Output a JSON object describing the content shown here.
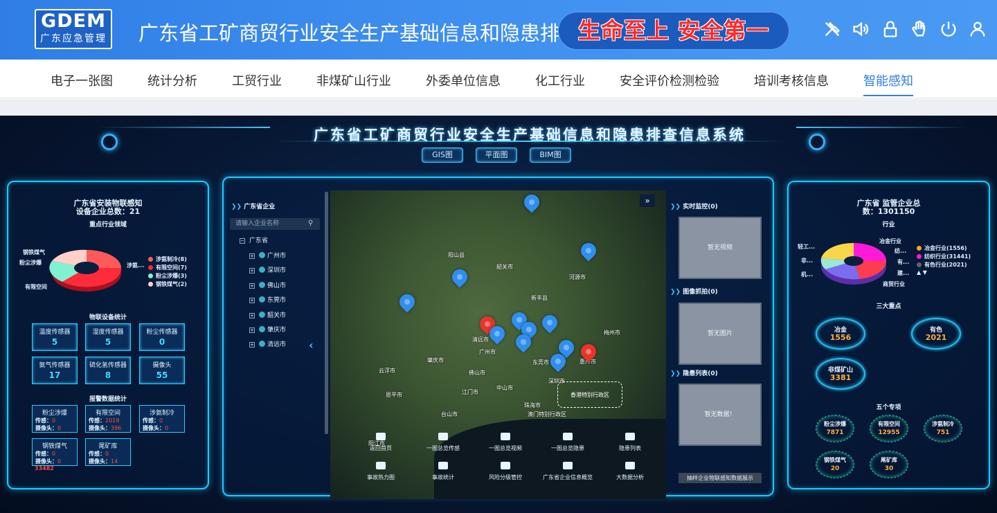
{
  "header": {
    "logo_main": "GDEM",
    "logo_sub": "广东应急管理",
    "title": "广东省工矿商贸行业安全生产基础信息和隐患排查信息系统",
    "slogan": "生命至上 安全第一",
    "icons": [
      "tools-icon",
      "speaker-icon",
      "lock-icon",
      "hand-icon",
      "power-icon",
      "user-icon"
    ]
  },
  "nav": {
    "items": [
      "电子一张图",
      "统计分析",
      "工贸行业",
      "非煤矿山行业",
      "外委单位信息",
      "化工行业",
      "安全评价检测检验",
      "培训考核信息",
      "智能感知"
    ],
    "active_index": 8
  },
  "dashboard": {
    "title": "广东省工矿商贸行业安全生产基础信息和隐患排查信息系统",
    "tabs": [
      "GIS图",
      "平面图",
      "BIM图"
    ]
  },
  "left_panel": {
    "title_line1": "广东省安装物联感知",
    "title_line2": "设备企业总数：21",
    "key_industry_title": "重点行业领域",
    "pie_labels": [
      "钢铁煤气",
      "粉尘涉爆",
      "有限空间",
      "涉氨..."
    ],
    "pie_legend": [
      {
        "label": "涉氨制冷(8)",
        "color": "#ff5a5a"
      },
      {
        "label": "有限空间(7)",
        "color": "#ff2b3a"
      },
      {
        "label": "粉尘涉爆(3)",
        "color": "#7ff2d2"
      },
      {
        "label": "钢铁煤气(2)",
        "color": "#ffd0c8"
      }
    ],
    "sensor_title": "物联设备统计",
    "sensors": [
      {
        "label": "温度传感器",
        "value": "5"
      },
      {
        "label": "湿度传感器",
        "value": "5"
      },
      {
        "label": "粉尘传感器",
        "value": "0"
      },
      {
        "label": "氨气传感器",
        "value": "17"
      },
      {
        "label": "硫化氢传感器",
        "value": "8"
      },
      {
        "label": "摄像头",
        "value": "55"
      }
    ],
    "alarm_title": "报警数据统计",
    "alarms": [
      {
        "title": "粉尘涉爆",
        "sensor_label": "传感：",
        "sensor_value": "0",
        "camera_label": "摄像头：",
        "camera_value": "0"
      },
      {
        "title": "有限空间",
        "sensor_label": "传感：",
        "sensor_value": "2019",
        "camera_label": "摄像头：",
        "camera_value": "396"
      },
      {
        "title": "涉氨制冷",
        "sensor_label": "传感：",
        "sensor_value": "0",
        "camera_label": "摄像头：",
        "camera_value": "0"
      },
      {
        "title": "钢铁煤气",
        "sensor_label": "传感：",
        "sensor_value": "0",
        "camera_label": "摄像头：",
        "camera_value": "0"
      },
      {
        "title": "尾矿库",
        "sensor_label": "传感：",
        "sensor_value": "0",
        "camera_label": "摄像头：",
        "camera_value": "14"
      }
    ],
    "extra_value": "33482"
  },
  "center_panel": {
    "tree_title": "广东省企业",
    "search_placeholder": "请输入企业名称",
    "root": "广东省",
    "cities": [
      "广州市",
      "深圳市",
      "佛山市",
      "东莞市",
      "韶关市",
      "肇庆市",
      "清远市"
    ],
    "map_labels": [
      "梅州市",
      "河源市",
      "清远市",
      "肇庆市",
      "广州市",
      "佛山市",
      "江门市",
      "中山市",
      "珠海市",
      "东莞市",
      "深圳市",
      "惠州市",
      "韶关市",
      "阳山县",
      "新丰县",
      "云浮市",
      "台山市",
      "阳江市",
      "恩平市"
    ],
    "hk_label": "香港特别行政区",
    "macao_label": "澳门特别行政区",
    "map_buttons_row1": [
      "返回首页",
      "一图总览传感",
      "一图总览视频",
      "一图总览隐患",
      "隐患列表"
    ],
    "map_buttons_row2": [
      "事故热力图",
      "事故统计",
      "风险分级管控",
      "广东省企业信息概览",
      "大数据分析"
    ],
    "right_col": {
      "live_title": "实时监控(0)",
      "live_empty": "暂无视频",
      "capture_title": "图像抓拍(0)",
      "capture_empty": "暂无图片",
      "hazard_title": "隐患列表(0)",
      "hazard_empty": "暂无数据！",
      "demo_button": "抽样企业物联感知数据展示"
    }
  },
  "right_panel": {
    "title_line1": "广东省 监管企业总",
    "title_line2": "数：1301150",
    "industry_title": "行业",
    "pie_labels_left": [
      "轻工...",
      "非...",
      "机..."
    ],
    "pie_labels_right": [
      "冶金行业",
      "纺...",
      "有...",
      "建..."
    ],
    "pie_label_bottom": "商贸行业",
    "legend": [
      {
        "label": "冶金行业(1556)",
        "color": "#f5a623"
      },
      {
        "label": "纺织行业(31441)",
        "color": "#ff19d9"
      },
      {
        "label": "有色行业(2021)",
        "color": "#5b6378"
      }
    ],
    "three_title": "三大重点",
    "three": [
      {
        "name": "冶金",
        "value": "1556"
      },
      {
        "name": "有色",
        "value": "2021"
      },
      {
        "name": "非煤矿山",
        "value": "3381"
      }
    ],
    "five_title": "五个专项",
    "five": [
      {
        "name": "粉尘涉爆",
        "value": "7871"
      },
      {
        "name": "有限空间",
        "value": "12955"
      },
      {
        "name": "涉氨制冷",
        "value": "751"
      },
      {
        "name": "钢铁煤气",
        "value": "20"
      },
      {
        "name": "尾矿库",
        "value": "30"
      }
    ]
  }
}
